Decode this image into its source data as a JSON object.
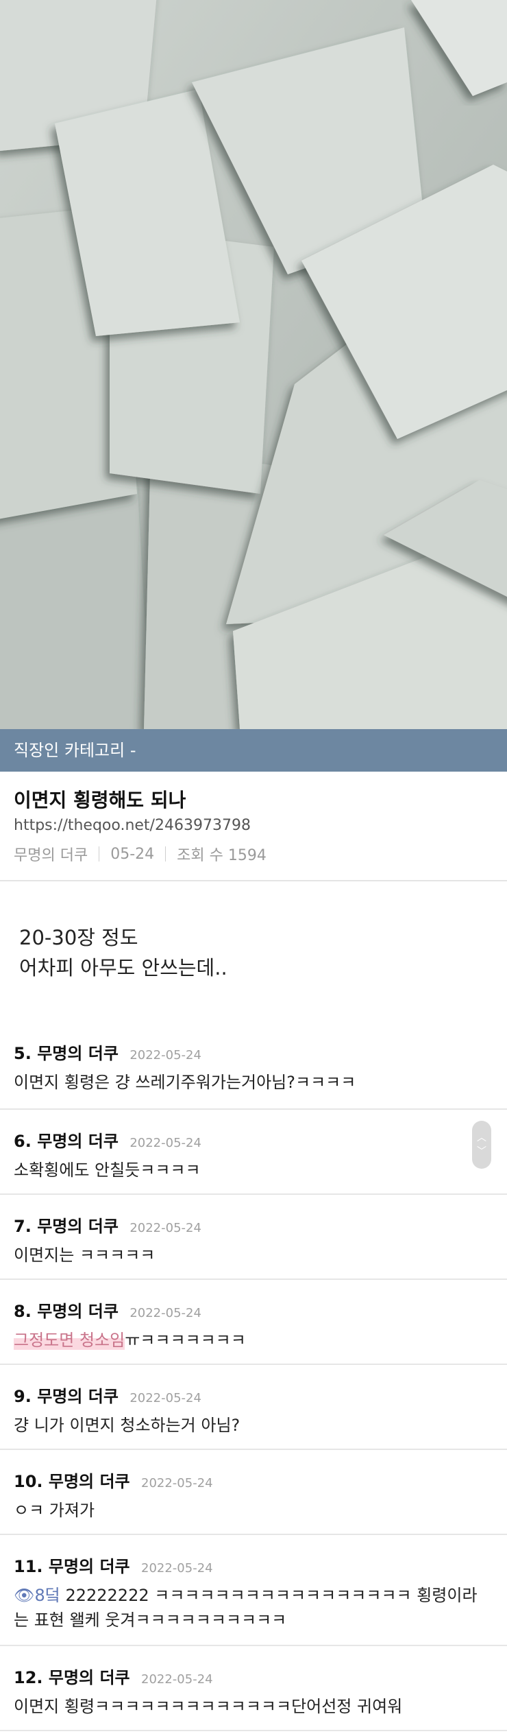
{
  "category": {
    "label": "직장인 카테고리 -"
  },
  "post": {
    "title": "이면지 횡령해도 되나",
    "url": "https://theqoo.net/2463973798",
    "author": "무명의 더쿠",
    "date": "05-24",
    "views_label": "조회 수 1594",
    "body_lines": [
      "20-30장 정도",
      "어차피 아무도 안쓰는데.."
    ]
  },
  "comments": [
    {
      "num": "5.",
      "author": "무명의 더쿠",
      "date": "2022-05-24",
      "text": "이면지 횡령은 걍 쓰레기주워가는거아님?ㅋㅋㅋㅋ"
    },
    {
      "num": "6.",
      "author": "무명의 더쿠",
      "date": "2022-05-24",
      "text": "소확횡에도 안칠듯ㅋㅋㅋㅋ"
    },
    {
      "num": "7.",
      "author": "무명의 더쿠",
      "date": "2022-05-24",
      "text": "이면지는 ㅋㅋㅋㅋㅋ"
    },
    {
      "num": "8.",
      "author": "무명의 더쿠",
      "date": "2022-05-24",
      "text_highlight": "그정도면 청소임",
      "text_rest": "ㅠㅋㅋㅋㅋㅋㅋㅋ"
    },
    {
      "num": "9.",
      "author": "무명의 더쿠",
      "date": "2022-05-24",
      "text": "걍 니가 이면지 청소하는거 아님?"
    },
    {
      "num": "10.",
      "author": "무명의 더쿠",
      "date": "2022-05-24",
      "text": "ㅇㅋ 가져가"
    },
    {
      "num": "11.",
      "author": "무명의 더쿠",
      "date": "2022-05-24",
      "eye": "👁8덬",
      "text": " 22222222 ㅋㅋㅋㅋㅋㅋㅋㅋㅋㅋㅋㅋㅋㅋㅋㅋㅋ 횡령이라는 표현 왤케 웃겨ㅋㅋㅋㅋㅋㅋㅋㅋㅋㅋ"
    },
    {
      "num": "12.",
      "author": "무명의 더쿠",
      "date": "2022-05-24",
      "text": "이면지 횡령ㅋㅋㅋㅋㅋㅋㅋㅋㅋㅋㅋㅋㅋ단어선정 귀여워"
    }
  ],
  "scroll_control": {
    "up_icon": "chevron-up-icon",
    "down_icon": "chevron-down-icon"
  }
}
